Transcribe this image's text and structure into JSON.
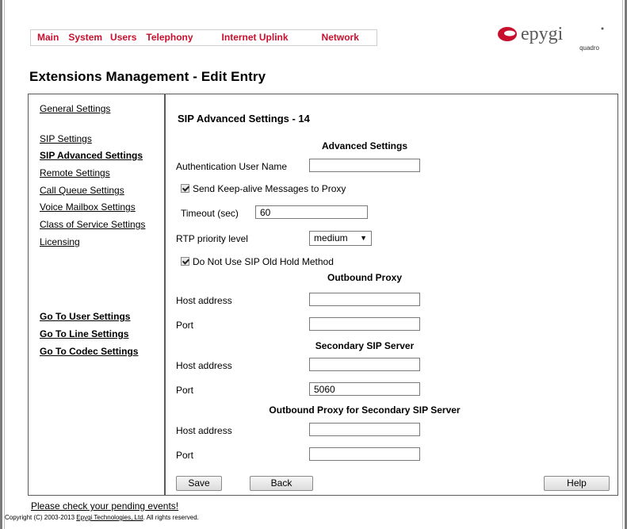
{
  "topnav": [
    "Main",
    "System",
    "Users",
    "Telephony",
    "Internet Uplink",
    "Network"
  ],
  "logo": {
    "name": "epygi",
    "sub": "quadro",
    "brand_color": "#c8102e"
  },
  "page_title": "Extensions Management - Edit Entry",
  "sidebar": {
    "general": "General Settings",
    "items": [
      "SIP Settings",
      "SIP Advanced Settings",
      "Remote Settings",
      "Call Queue Settings",
      "Voice Mailbox Settings",
      "Class of Service Settings",
      "Licensing"
    ],
    "goto": [
      "Go To User Settings",
      "Go To Line Settings",
      "Go To Codec Settings"
    ]
  },
  "main": {
    "section_title": "SIP Advanced Settings - 14",
    "advanced_heading": "Advanced Settings",
    "auth_user_label": "Authentication User Name",
    "auth_user_value": "",
    "keepalive_label": "Send Keep-alive Messages to Proxy",
    "keepalive_checked": true,
    "timeout_label": "Timeout (sec)",
    "timeout_value": "60",
    "rtp_label": "RTP priority level",
    "rtp_value": "medium",
    "no_old_hold_label": "Do Not Use SIP Old Hold Method",
    "no_old_hold_checked": true,
    "outbound_heading": "Outbound Proxy",
    "outbound_host_label": "Host address",
    "outbound_host_value": "",
    "outbound_port_label": "Port",
    "outbound_port_value": "",
    "secondary_heading": "Secondary SIP Server",
    "secondary_host_label": "Host address",
    "secondary_host_value": "",
    "secondary_port_label": "Port",
    "secondary_port_value": "5060",
    "outbound2_heading": "Outbound Proxy for Secondary SIP Server",
    "outbound2_host_label": "Host address",
    "outbound2_host_value": "",
    "outbound2_port_label": "Port",
    "outbound2_port_value": "",
    "save": "Save",
    "back": "Back",
    "help": "Help"
  },
  "footer": {
    "pending": "Please check your pending events!",
    "copyright_pre": "Copyright (C) 2003-2013",
    "copyright_link": "Epygi Technologies, Ltd",
    "copyright_post": ". All rights reserved."
  }
}
